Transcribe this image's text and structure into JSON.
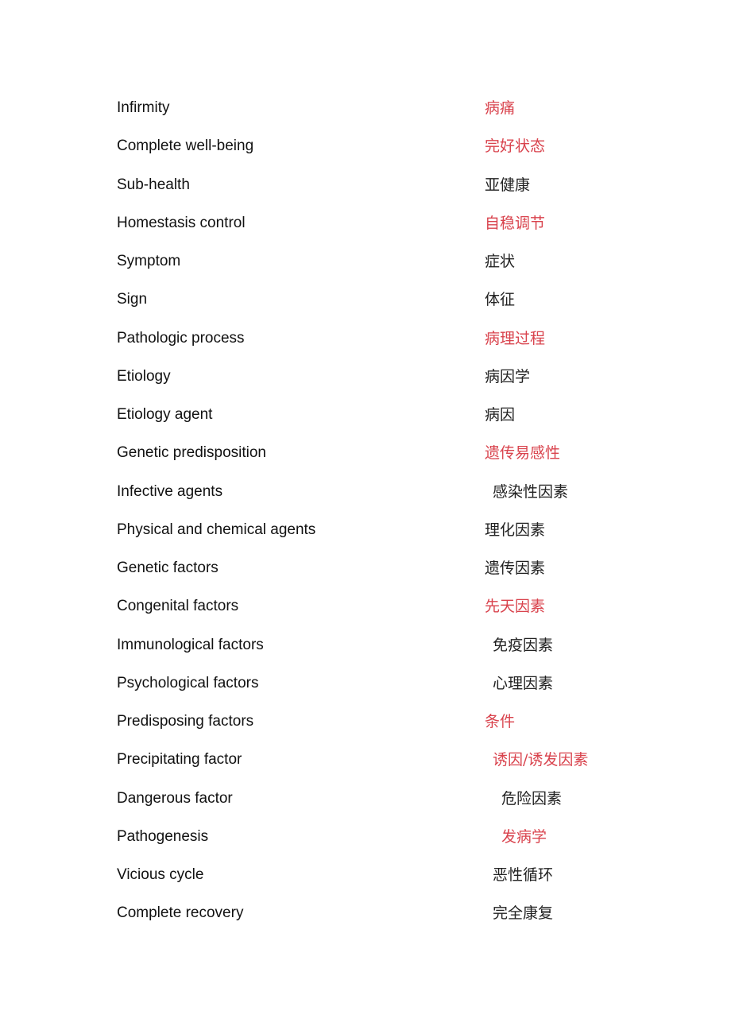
{
  "colors": {
    "highlight": "#d9434d",
    "normal": "#222222"
  },
  "terms": [
    {
      "en": "Infirmity",
      "zh": "病痛",
      "highlight": true,
      "indent": 0
    },
    {
      "en": "Complete well-being",
      "zh": "完好状态",
      "highlight": true,
      "indent": 0
    },
    {
      "en": "Sub-health",
      "zh": "亚健康",
      "highlight": false,
      "indent": 0
    },
    {
      "en": "Homestasis control",
      "zh": "自稳调节",
      "highlight": true,
      "indent": 0
    },
    {
      "en": "Symptom",
      "zh": "症状",
      "highlight": false,
      "indent": 0
    },
    {
      "en": "Sign",
      "zh": "体征",
      "highlight": false,
      "indent": 0
    },
    {
      "en": "Pathologic process",
      "zh": "病理过程",
      "highlight": true,
      "indent": 0
    },
    {
      "en": "Etiology",
      "zh": "病因学",
      "highlight": false,
      "indent": 0
    },
    {
      "en": "Etiology agent",
      "zh": "病因",
      "highlight": false,
      "indent": 0
    },
    {
      "en": "Genetic predisposition",
      "zh": "遗传易感性",
      "highlight": true,
      "indent": 0
    },
    {
      "en": "Infective agents",
      "zh": "感染性因素",
      "highlight": false,
      "indent": 1
    },
    {
      "en": "Physical and chemical agents",
      "zh": "理化因素",
      "highlight": false,
      "indent": 0
    },
    {
      "en": "Genetic factors",
      "zh": "遗传因素",
      "highlight": false,
      "indent": 0
    },
    {
      "en": "Congenital factors",
      "zh": "先天因素",
      "highlight": true,
      "indent": 0
    },
    {
      "en": "Immunological factors",
      "zh": "免疫因素",
      "highlight": false,
      "indent": 1
    },
    {
      "en": "Psychological factors",
      "zh": "心理因素",
      "highlight": false,
      "indent": 1
    },
    {
      "en": "Predisposing factors",
      "zh": "条件",
      "highlight": true,
      "indent": 0
    },
    {
      "en": "Precipitating factor",
      "zh": "诱因/诱发因素",
      "highlight": true,
      "indent": 1
    },
    {
      "en": "Dangerous factor",
      "zh": "危险因素",
      "highlight": false,
      "indent": 2
    },
    {
      "en": "Pathogenesis",
      "zh": "发病学",
      "highlight": true,
      "indent": 2
    },
    {
      "en": "Vicious cycle",
      "zh": "恶性循环",
      "highlight": false,
      "indent": 1
    },
    {
      "en": "Complete recovery",
      "zh": "完全康复",
      "highlight": false,
      "indent": 1
    }
  ]
}
